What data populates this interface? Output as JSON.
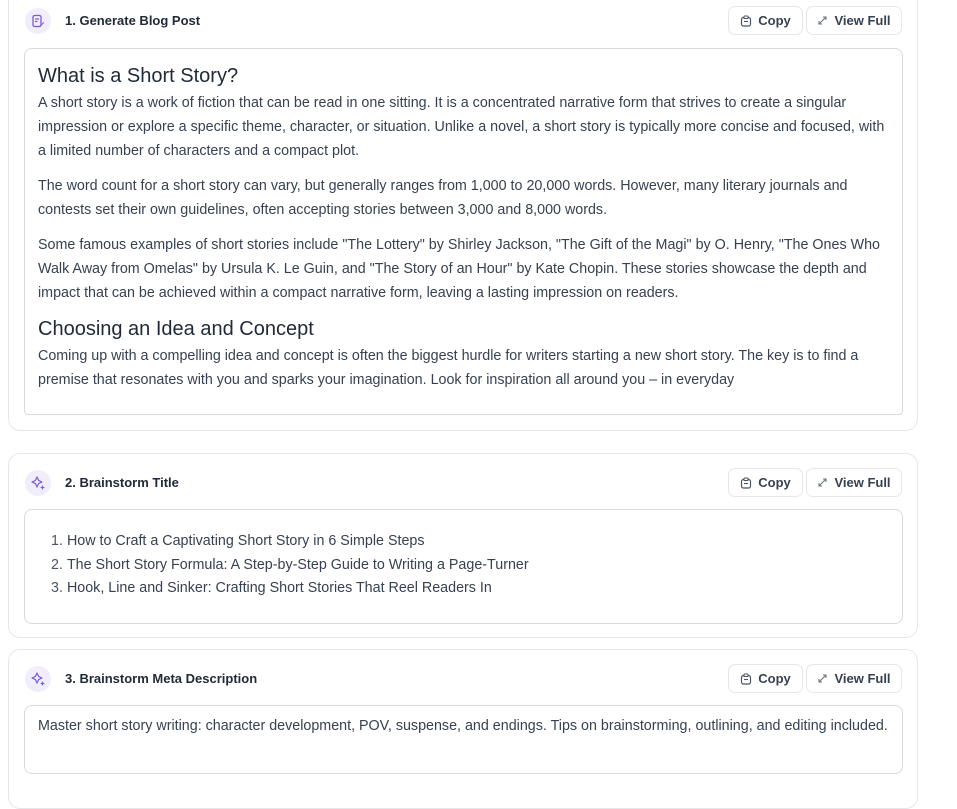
{
  "steps": [
    {
      "title": "1. Generate Blog Post",
      "icon": "edit-document-icon",
      "copy_label": "Copy",
      "view_label": "View Full",
      "content": {
        "h1": "What is a Short Story?",
        "p1": "A short story is a work of fiction that can be read in one sitting. It is a concentrated narrative form that strives to create a singular impression or explore a specific theme, character, or situation. Unlike a novel, a short story is typically more concise and focused, with a limited number of characters and a compact plot.",
        "p2": "The word count for a short story can vary, but generally ranges from 1,000 to 20,000 words. However, many literary journals and contests set their own guidelines, often accepting stories between 3,000 and 8,000 words.",
        "p3": "Some famous examples of short stories include \"The Lottery\" by Shirley Jackson, \"The Gift of the Magi\" by O. Henry, \"The Ones Who Walk Away from Omelas\" by Ursula K. Le Guin, and \"The Story of an Hour\" by Kate Chopin. These stories showcase the depth and impact that can be achieved within a compact narrative form, leaving a lasting impression on readers.",
        "h2": "Choosing an Idea and Concept",
        "p4": "Coming up with a compelling idea and concept is often the biggest hurdle for writers starting a new short story. The key is to find a premise that resonates with you and sparks your imagination. Look for inspiration all around you – in everyday"
      }
    },
    {
      "title": "2. Brainstorm Title",
      "icon": "sparkle-icon",
      "copy_label": "Copy",
      "view_label": "View Full",
      "items": [
        {
          "num": "1.",
          "text": "How to Craft a Captivating Short Story in 6 Simple Steps"
        },
        {
          "num": "2.",
          "text": "The Short Story Formula: A Step-by-Step Guide to Writing a Page-Turner"
        },
        {
          "num": "3.",
          "text": "Hook, Line and Sinker: Crafting Short Stories That Reel Readers In"
        }
      ]
    },
    {
      "title": "3. Brainstorm Meta Description",
      "icon": "sparkle-icon",
      "copy_label": "Copy",
      "view_label": "View Full",
      "text": "Master short story writing: character development, POV, suspense, and endings. Tips on brainstorming, outlining, and editing included."
    }
  ],
  "colors": {
    "accent": "#7c5cd6",
    "icon_bg": "#f1edfb",
    "border": "#e5e7eb",
    "text": "#374151"
  }
}
